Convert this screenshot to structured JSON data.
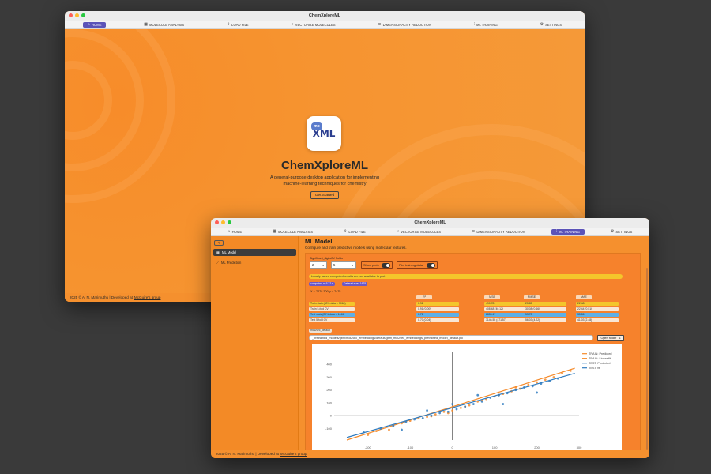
{
  "colors": {
    "accent": "#5b53b8",
    "orange": "#f5902e",
    "dark": "#3c3c3c",
    "train": "#f58a2a",
    "test": "#2f7bbf"
  },
  "window_main": {
    "title": "ChemXploreML",
    "tabs": [
      {
        "label": "HOME",
        "icon": "home-icon",
        "active": true
      },
      {
        "label": "MOLECULE ANALYSIS",
        "icon": "grid-icon",
        "active": false
      },
      {
        "label": "LOAD FILE",
        "icon": "load-icon",
        "active": false
      },
      {
        "label": "VECTORIZE MOLECULES",
        "icon": "code-icon",
        "active": false
      },
      {
        "label": "DIMENSIONALITY REDUCTION",
        "icon": "layers-icon",
        "active": false
      },
      {
        "label": "ML TRAINING",
        "icon": "sliders-icon",
        "active": false
      },
      {
        "label": "SETTINGS",
        "icon": "gear-icon",
        "active": false
      }
    ],
    "logo_text": "XML",
    "logo_badge": "mo",
    "app_name": "ChemXploreML",
    "tagline_line1": "A general-purpose desktop application for implementing",
    "tagline_line2": "machine-learning techniques for chemistry",
    "get_started": "Get Started",
    "footer_text": "2025 © A. N. Marimuthu | Developed at",
    "footer_link": "McGuire's group"
  },
  "window_ml": {
    "title": "ChemXploreML",
    "tabs": [
      {
        "label": "HOME",
        "icon": "home-icon",
        "active": false
      },
      {
        "label": "MOLECULE ANALYSIS",
        "icon": "grid-icon",
        "active": false
      },
      {
        "label": "LOAD FILE",
        "icon": "load-icon",
        "active": false
      },
      {
        "label": "VECTORIZE MOLECULES",
        "icon": "code-icon",
        "active": false
      },
      {
        "label": "DIMENSIONALITY REDUCTION",
        "icon": "layers-icon",
        "active": false
      },
      {
        "label": "ML TRAINING",
        "icon": "sliders-icon",
        "active": true
      },
      {
        "label": "SETTINGS",
        "icon": "gear-icon",
        "active": false
      }
    ],
    "back_label": "<",
    "sidebar": [
      {
        "label": "ML Model",
        "icon": "model-icon",
        "active": true
      },
      {
        "label": "ML Prediction",
        "icon": "wand-icon",
        "active": false
      }
    ],
    "main_title": "ML Model",
    "main_subtitle": "Configure and train predictive models using molecular features.",
    "controls": {
      "sig_digits_label": "Significant_digits",
      "sig_digits_value": "2",
      "cv_folds_label": "CV Folds",
      "cv_folds_value": "5",
      "show_plots": "Show plots",
      "plot_training": "Plot training data"
    },
    "warning": "Locally saved computed results are not available to plot",
    "pill_computed": "computed at 6.22 s",
    "pill_dataset": "Dataset size: 1475",
    "coords": "X = 7478.300   y = 7475",
    "metrics": {
      "headers": [
        "R²",
        "MSE",
        "RMSE",
        "MAE"
      ],
      "rows": [
        {
          "label": "Train stats (80% data = 5060)",
          "values": [
            "0.92",
            "490.78",
            "25.85",
            "22.48"
          ],
          "style": "yellow"
        },
        {
          "label": "Train 5-fold CV",
          "values": [
            "0.91 (0.00)",
            "408.48 (40.12)",
            "30.08 (0.66)",
            "22.44 (0.51)"
          ],
          "style": "plain"
        },
        {
          "label": "Test stats (20% data = 1446)",
          "values": [
            "0.72",
            "2855.47",
            "53.78",
            "35.86"
          ],
          "style": "blue"
        },
        {
          "label": "Test 5-fold CV",
          "values": [
            "0.70 (0.04)",
            "3146.55 (471.57)",
            "56.03 (4.22)",
            "41.03 (2.48)"
          ],
          "style": "plain"
        }
      ]
    },
    "model_tag": "mol2vec_default",
    "model_path": "_pretrained_models/gbm/mol2vec_embeddings/default/gbm_mol2vec_embeddings_pretrained_model_default.pkl",
    "open_folder": "Open folder",
    "footer_text": "2025 © A. N. Marimuthu | Developed at",
    "footer_link": "McGuire's group"
  },
  "chart_data": {
    "type": "scatter",
    "title": "",
    "xlabel": "",
    "ylabel": "",
    "xlim": [
      -280,
      300
    ],
    "ylim": [
      -190,
      500
    ],
    "x_ticks": [
      "-200",
      "-100",
      "0",
      "100",
      "200",
      "300"
    ],
    "y_ticks": [
      "400",
      "300",
      "200",
      "100",
      "0",
      "-100",
      "-200"
    ],
    "legend": [
      "TRAIN: Predicted",
      "TRAIN: Linear fit",
      "TEST: Predicted",
      "TEST: fit"
    ],
    "legend_position": "top-right",
    "series": [
      {
        "name": "TRAIN: Predicted",
        "kind": "points",
        "color": "#f58a2a",
        "points": [
          [
            -200,
            -150
          ],
          [
            -180,
            -120
          ],
          [
            -150,
            -110
          ],
          [
            -120,
            -60
          ],
          [
            -100,
            -40
          ],
          [
            -80,
            -20
          ],
          [
            -60,
            -10
          ],
          [
            -40,
            10
          ],
          [
            -20,
            30
          ],
          [
            0,
            40
          ],
          [
            20,
            60
          ],
          [
            40,
            80
          ],
          [
            60,
            110
          ],
          [
            80,
            130
          ],
          [
            100,
            150
          ],
          [
            120,
            170
          ],
          [
            140,
            190
          ],
          [
            160,
            210
          ],
          [
            180,
            240
          ],
          [
            200,
            260
          ],
          [
            220,
            280
          ],
          [
            240,
            300
          ],
          [
            260,
            330
          ],
          [
            280,
            350
          ],
          [
            150,
            220
          ],
          [
            110,
            160
          ],
          [
            70,
            120
          ],
          [
            30,
            70
          ],
          [
            -10,
            20
          ],
          [
            -50,
            -5
          ]
        ]
      },
      {
        "name": "TRAIN: Linear fit",
        "kind": "line",
        "color": "#f58a2a",
        "points": [
          [
            -250,
            -190
          ],
          [
            290,
            370
          ]
        ]
      },
      {
        "name": "TEST: Predicted",
        "kind": "points",
        "color": "#2f7bbf",
        "points": [
          [
            -210,
            -130
          ],
          [
            -170,
            -100
          ],
          [
            -140,
            -80
          ],
          [
            -110,
            -50
          ],
          [
            -90,
            -30
          ],
          [
            -70,
            -20
          ],
          [
            -50,
            0
          ],
          [
            -30,
            20
          ],
          [
            -10,
            30
          ],
          [
            10,
            50
          ],
          [
            30,
            70
          ],
          [
            50,
            90
          ],
          [
            70,
            110
          ],
          [
            90,
            140
          ],
          [
            110,
            160
          ],
          [
            130,
            175
          ],
          [
            150,
            200
          ],
          [
            170,
            220
          ],
          [
            190,
            230
          ],
          [
            210,
            250
          ],
          [
            230,
            270
          ],
          [
            250,
            290
          ],
          [
            60,
            160
          ],
          [
            0,
            90
          ],
          [
            -60,
            40
          ],
          [
            120,
            90
          ],
          [
            200,
            180
          ],
          [
            -120,
            -110
          ]
        ]
      },
      {
        "name": "TEST: fit",
        "kind": "line",
        "color": "#2f7bbf",
        "points": [
          [
            -250,
            -170
          ],
          [
            290,
            330
          ]
        ]
      }
    ]
  }
}
